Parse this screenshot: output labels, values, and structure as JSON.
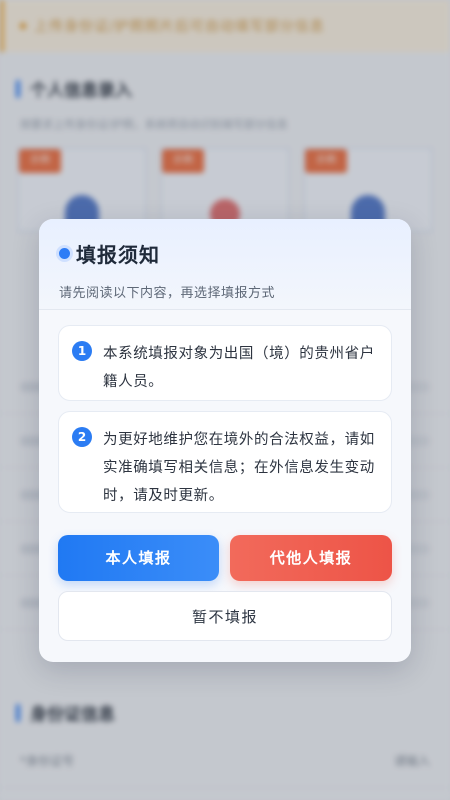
{
  "background": {
    "notice": "上传身份证/护照照片后可自动填写部分信息",
    "section_personal": "个人信息录入",
    "section_personal_desc": "按要求上传身份证/护照，系统将自动识别填写部分信息",
    "photo_tags": [
      "示例",
      "示例",
      "示例"
    ],
    "section_id": "身份证信息",
    "id_row_label": "*身份证号",
    "id_row_value": "请输入"
  },
  "dialog": {
    "title": "填报须知",
    "subtitle": "请先阅读以下内容，再选择填报方式",
    "notices": [
      {
        "num": "1",
        "text": "本系统填报对象为出国（境）的贵州省户籍人员。"
      },
      {
        "num": "2",
        "text": "为更好地维护您在境外的合法权益，请如实准确填写相关信息；在外信息发生变动时，请及时更新。"
      }
    ],
    "buttons": {
      "self": "本人填报",
      "proxy": "代他人填报",
      "skip": "暂不填报"
    }
  },
  "colors": {
    "primary": "#2d7cf6",
    "danger": "#ef5a4a",
    "notice_bg": "#fdf3e2"
  }
}
